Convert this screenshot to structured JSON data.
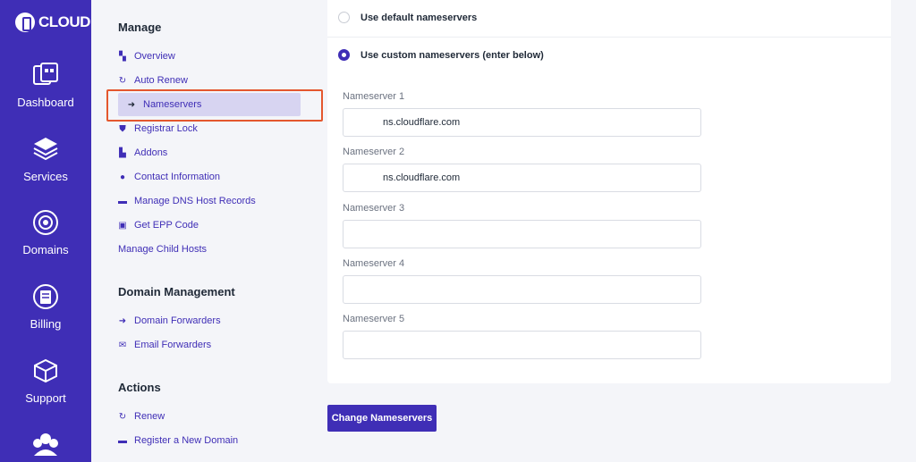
{
  "brand": {
    "name": "CLOUD"
  },
  "rail": {
    "items": [
      {
        "label": "Dashboard",
        "icon": "dashboard-icon"
      },
      {
        "label": "Services",
        "icon": "services-icon"
      },
      {
        "label": "Domains",
        "icon": "domains-icon"
      },
      {
        "label": "Billing",
        "icon": "billing-icon"
      },
      {
        "label": "Support",
        "icon": "support-icon"
      },
      {
        "label": "",
        "icon": "users-icon"
      }
    ]
  },
  "menu": {
    "manage": {
      "heading": "Manage",
      "items": [
        {
          "label": "Overview",
          "icon": "overview-icon"
        },
        {
          "label": "Auto Renew",
          "icon": "refresh-icon"
        },
        {
          "label": "Nameservers",
          "icon": "arrow-forward-icon",
          "active": true
        },
        {
          "label": "Registrar Lock",
          "icon": "shield-icon"
        },
        {
          "label": "Addons",
          "icon": "addons-icon"
        },
        {
          "label": "Contact Information",
          "icon": "user-icon"
        },
        {
          "label": "Manage DNS Host Records",
          "icon": "tag-icon"
        },
        {
          "label": "Get EPP Code",
          "icon": "code-icon"
        },
        {
          "label": "Manage Child Hosts",
          "icon": ""
        }
      ]
    },
    "domain_management": {
      "heading": "Domain Management",
      "items": [
        {
          "label": "Domain Forwarders",
          "icon": "arrow-forward-icon"
        },
        {
          "label": "Email Forwarders",
          "icon": "mail-icon"
        }
      ]
    },
    "actions": {
      "heading": "Actions",
      "items": [
        {
          "label": "Renew",
          "icon": "refresh-icon"
        },
        {
          "label": "Register a New Domain",
          "icon": "tag-icon"
        }
      ]
    }
  },
  "nameservers": {
    "option_default": "Use default nameservers",
    "option_custom": "Use custom nameservers (enter below)",
    "selected": "custom",
    "fields": [
      {
        "label": "Nameserver 1",
        "value": "ns.cloudflare.com"
      },
      {
        "label": "Nameserver 2",
        "value": "ns.cloudflare.com"
      },
      {
        "label": "Nameserver 3",
        "value": ""
      },
      {
        "label": "Nameserver 4",
        "value": ""
      },
      {
        "label": "Nameserver 5",
        "value": ""
      }
    ],
    "submit_label": "Change Nameservers"
  },
  "colors": {
    "accent": "#3f2eb6",
    "highlight": "#e4572e",
    "active_bg": "#d7d4f1"
  }
}
